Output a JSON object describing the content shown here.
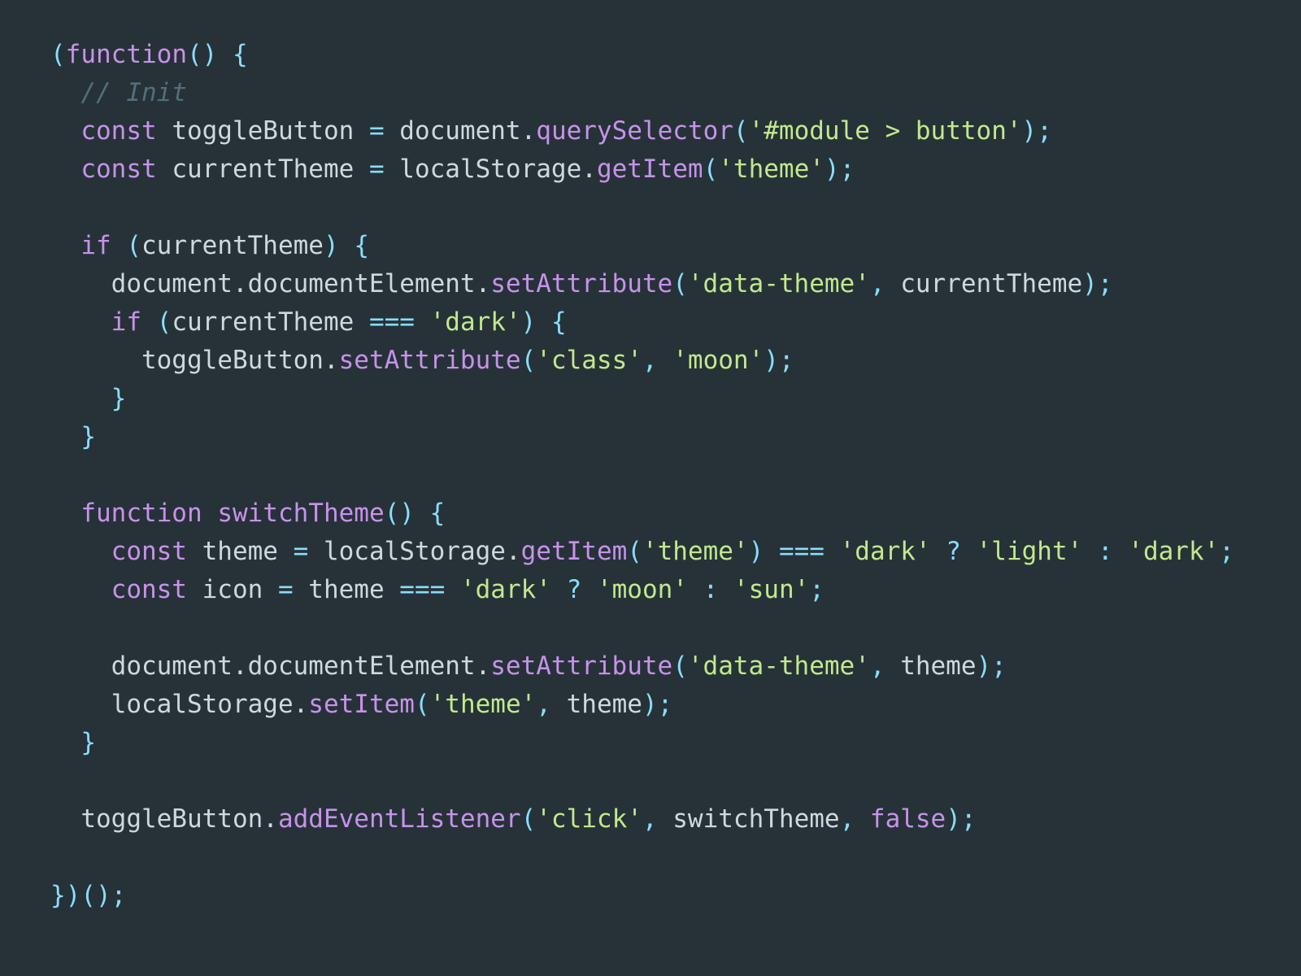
{
  "editor": {
    "language": "javascript",
    "background_color": "#263238",
    "default_text_color": "#cfd8dc",
    "theme_name": "material-dark",
    "font_size_px": 31,
    "line_height_px": 47
  },
  "palette": {
    "keyword": "#c792ea",
    "function": "#c792ea",
    "punctuation": "#89ddff",
    "string": "#c3e88d",
    "comment": "#546e7a",
    "plain": "#cfd8dc"
  },
  "code": {
    "lines": [
      {
        "number": 1,
        "indent": 0,
        "text": "(function() {",
        "tokens": [
          {
            "text": "(",
            "type": "punct"
          },
          {
            "text": "function",
            "type": "kw"
          },
          {
            "text": "()",
            "type": "punct"
          },
          {
            "text": " ",
            "type": "plain"
          },
          {
            "text": "{",
            "type": "punct"
          }
        ]
      },
      {
        "number": 2,
        "indent": 1,
        "text": "// Init",
        "tokens": [
          {
            "text": "// Init",
            "type": "comment"
          }
        ]
      },
      {
        "number": 3,
        "indent": 1,
        "text": "const toggleButton = document.querySelector('#module > button');",
        "tokens": [
          {
            "text": "const",
            "type": "kw"
          },
          {
            "text": " toggleButton ",
            "type": "plain"
          },
          {
            "text": "=",
            "type": "punct"
          },
          {
            "text": " document",
            "type": "plain"
          },
          {
            "text": ".",
            "type": "plain"
          },
          {
            "text": "querySelector",
            "type": "fn"
          },
          {
            "text": "(",
            "type": "punct"
          },
          {
            "text": "'#module > button'",
            "type": "str"
          },
          {
            "text": ");",
            "type": "punct"
          }
        ]
      },
      {
        "number": 4,
        "indent": 1,
        "text": "const currentTheme = localStorage.getItem('theme');",
        "tokens": [
          {
            "text": "const",
            "type": "kw"
          },
          {
            "text": " currentTheme ",
            "type": "plain"
          },
          {
            "text": "=",
            "type": "punct"
          },
          {
            "text": " localStorage",
            "type": "plain"
          },
          {
            "text": ".",
            "type": "plain"
          },
          {
            "text": "getItem",
            "type": "fn"
          },
          {
            "text": "(",
            "type": "punct"
          },
          {
            "text": "'theme'",
            "type": "str"
          },
          {
            "text": ");",
            "type": "punct"
          }
        ]
      },
      {
        "number": 5,
        "indent": 0,
        "text": "",
        "tokens": []
      },
      {
        "number": 6,
        "indent": 1,
        "text": "if (currentTheme) {",
        "tokens": [
          {
            "text": "if",
            "type": "kw"
          },
          {
            "text": " ",
            "type": "plain"
          },
          {
            "text": "(",
            "type": "punct"
          },
          {
            "text": "currentTheme",
            "type": "plain"
          },
          {
            "text": ")",
            "type": "punct"
          },
          {
            "text": " ",
            "type": "plain"
          },
          {
            "text": "{",
            "type": "punct"
          }
        ]
      },
      {
        "number": 7,
        "indent": 2,
        "text": "document.documentElement.setAttribute('data-theme', currentTheme);",
        "tokens": [
          {
            "text": "document.documentElement.",
            "type": "plain"
          },
          {
            "text": "setAttribute",
            "type": "fn"
          },
          {
            "text": "(",
            "type": "punct"
          },
          {
            "text": "'data-theme'",
            "type": "str"
          },
          {
            "text": ",",
            "type": "punct"
          },
          {
            "text": " currentTheme",
            "type": "plain"
          },
          {
            "text": ");",
            "type": "punct"
          }
        ]
      },
      {
        "number": 8,
        "indent": 2,
        "text": "if (currentTheme === 'dark') {",
        "tokens": [
          {
            "text": "if",
            "type": "kw"
          },
          {
            "text": " ",
            "type": "plain"
          },
          {
            "text": "(",
            "type": "punct"
          },
          {
            "text": "currentTheme ",
            "type": "plain"
          },
          {
            "text": "===",
            "type": "punct"
          },
          {
            "text": " ",
            "type": "plain"
          },
          {
            "text": "'dark'",
            "type": "str"
          },
          {
            "text": ")",
            "type": "punct"
          },
          {
            "text": " ",
            "type": "plain"
          },
          {
            "text": "{",
            "type": "punct"
          }
        ]
      },
      {
        "number": 9,
        "indent": 3,
        "text": "toggleButton.setAttribute('class', 'moon');",
        "tokens": [
          {
            "text": "toggleButton.",
            "type": "plain"
          },
          {
            "text": "setAttribute",
            "type": "fn"
          },
          {
            "text": "(",
            "type": "punct"
          },
          {
            "text": "'class'",
            "type": "str"
          },
          {
            "text": ",",
            "type": "punct"
          },
          {
            "text": " ",
            "type": "plain"
          },
          {
            "text": "'moon'",
            "type": "str"
          },
          {
            "text": ");",
            "type": "punct"
          }
        ]
      },
      {
        "number": 10,
        "indent": 2,
        "text": "}",
        "tokens": [
          {
            "text": "}",
            "type": "punct"
          }
        ]
      },
      {
        "number": 11,
        "indent": 1,
        "text": "}",
        "tokens": [
          {
            "text": "}",
            "type": "punct"
          }
        ]
      },
      {
        "number": 12,
        "indent": 0,
        "text": "",
        "tokens": []
      },
      {
        "number": 13,
        "indent": 1,
        "text": "function switchTheme() {",
        "tokens": [
          {
            "text": "function",
            "type": "kw"
          },
          {
            "text": " ",
            "type": "plain"
          },
          {
            "text": "switchTheme",
            "type": "fn"
          },
          {
            "text": "()",
            "type": "punct"
          },
          {
            "text": " ",
            "type": "plain"
          },
          {
            "text": "{",
            "type": "punct"
          }
        ]
      },
      {
        "number": 14,
        "indent": 2,
        "text": "const theme = localStorage.getItem('theme') === 'dark' ? 'light' : 'dark';",
        "tokens": [
          {
            "text": "const",
            "type": "kw"
          },
          {
            "text": " theme ",
            "type": "plain"
          },
          {
            "text": "=",
            "type": "punct"
          },
          {
            "text": " localStorage",
            "type": "plain"
          },
          {
            "text": ".",
            "type": "plain"
          },
          {
            "text": "getItem",
            "type": "fn"
          },
          {
            "text": "(",
            "type": "punct"
          },
          {
            "text": "'theme'",
            "type": "str"
          },
          {
            "text": ")",
            "type": "punct"
          },
          {
            "text": " ",
            "type": "plain"
          },
          {
            "text": "===",
            "type": "punct"
          },
          {
            "text": " ",
            "type": "plain"
          },
          {
            "text": "'dark'",
            "type": "str"
          },
          {
            "text": " ",
            "type": "plain"
          },
          {
            "text": "?",
            "type": "punct"
          },
          {
            "text": " ",
            "type": "plain"
          },
          {
            "text": "'light'",
            "type": "str"
          },
          {
            "text": " ",
            "type": "plain"
          },
          {
            "text": ":",
            "type": "punct"
          },
          {
            "text": " ",
            "type": "plain"
          },
          {
            "text": "'dark'",
            "type": "str"
          },
          {
            "text": ";",
            "type": "punct"
          }
        ]
      },
      {
        "number": 15,
        "indent": 2,
        "text": "const icon = theme === 'dark' ? 'moon' : 'sun';",
        "tokens": [
          {
            "text": "const",
            "type": "kw"
          },
          {
            "text": " icon ",
            "type": "plain"
          },
          {
            "text": "=",
            "type": "punct"
          },
          {
            "text": " theme ",
            "type": "plain"
          },
          {
            "text": "===",
            "type": "punct"
          },
          {
            "text": " ",
            "type": "plain"
          },
          {
            "text": "'dark'",
            "type": "str"
          },
          {
            "text": " ",
            "type": "plain"
          },
          {
            "text": "?",
            "type": "punct"
          },
          {
            "text": " ",
            "type": "plain"
          },
          {
            "text": "'moon'",
            "type": "str"
          },
          {
            "text": " ",
            "type": "plain"
          },
          {
            "text": ":",
            "type": "punct"
          },
          {
            "text": " ",
            "type": "plain"
          },
          {
            "text": "'sun'",
            "type": "str"
          },
          {
            "text": ";",
            "type": "punct"
          }
        ]
      },
      {
        "number": 16,
        "indent": 0,
        "text": "",
        "tokens": []
      },
      {
        "number": 17,
        "indent": 2,
        "text": "document.documentElement.setAttribute('data-theme', theme);",
        "tokens": [
          {
            "text": "document.documentElement.",
            "type": "plain"
          },
          {
            "text": "setAttribute",
            "type": "fn"
          },
          {
            "text": "(",
            "type": "punct"
          },
          {
            "text": "'data-theme'",
            "type": "str"
          },
          {
            "text": ",",
            "type": "punct"
          },
          {
            "text": " theme",
            "type": "plain"
          },
          {
            "text": ");",
            "type": "punct"
          }
        ]
      },
      {
        "number": 18,
        "indent": 2,
        "text": "localStorage.setItem('theme', theme);",
        "tokens": [
          {
            "text": "localStorage.",
            "type": "plain"
          },
          {
            "text": "setItem",
            "type": "fn"
          },
          {
            "text": "(",
            "type": "punct"
          },
          {
            "text": "'theme'",
            "type": "str"
          },
          {
            "text": ",",
            "type": "punct"
          },
          {
            "text": " theme",
            "type": "plain"
          },
          {
            "text": ");",
            "type": "punct"
          }
        ]
      },
      {
        "number": 19,
        "indent": 1,
        "text": "}",
        "tokens": [
          {
            "text": "}",
            "type": "punct"
          }
        ]
      },
      {
        "number": 20,
        "indent": 0,
        "text": "",
        "tokens": []
      },
      {
        "number": 21,
        "indent": 1,
        "text": "toggleButton.addEventListener('click', switchTheme, false);",
        "tokens": [
          {
            "text": "toggleButton.",
            "type": "plain"
          },
          {
            "text": "addEventListener",
            "type": "fn"
          },
          {
            "text": "(",
            "type": "punct"
          },
          {
            "text": "'click'",
            "type": "str"
          },
          {
            "text": ",",
            "type": "punct"
          },
          {
            "text": " switchTheme",
            "type": "plain"
          },
          {
            "text": ",",
            "type": "punct"
          },
          {
            "text": " ",
            "type": "plain"
          },
          {
            "text": "false",
            "type": "kw"
          },
          {
            "text": ");",
            "type": "punct"
          }
        ]
      },
      {
        "number": 22,
        "indent": 0,
        "text": "",
        "tokens": []
      },
      {
        "number": 23,
        "indent": 0,
        "text": "})();",
        "tokens": [
          {
            "text": "})();",
            "type": "punct"
          }
        ]
      }
    ]
  }
}
